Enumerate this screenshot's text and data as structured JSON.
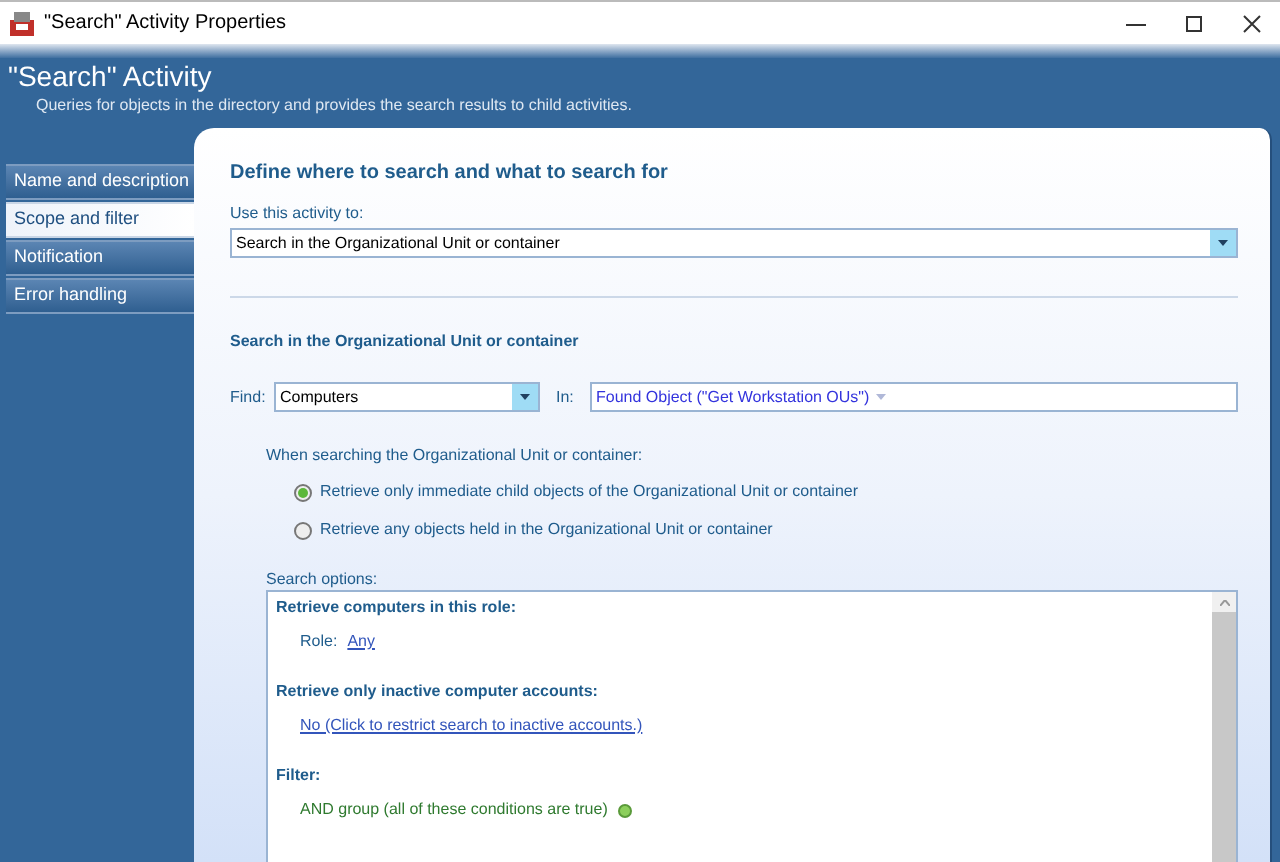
{
  "window": {
    "title": "\"Search\" Activity Properties"
  },
  "header": {
    "title": "\"Search\" Activity",
    "subtitle": "Queries for objects in the directory and provides the search results to child activities."
  },
  "sidebar": {
    "items": [
      {
        "label": "Name and description",
        "selected": false
      },
      {
        "label": "Scope and filter",
        "selected": true
      },
      {
        "label": "Notification",
        "selected": false
      },
      {
        "label": "Error handling",
        "selected": false
      }
    ]
  },
  "panel": {
    "heading": "Define where to search and what to search for",
    "use_label": "Use this activity to:",
    "use_value": "Search in the Organizational Unit or container",
    "section_heading": "Search in the Organizational Unit or container",
    "find_label": "Find:",
    "find_value": "Computers",
    "in_label": "In:",
    "in_value": "Found Object (\"Get Workstation OUs\")",
    "scope_label": "When searching the Organizational Unit or container:",
    "radios": [
      {
        "label": "Retrieve only immediate child objects of the Organizational Unit or container",
        "selected": true
      },
      {
        "label": "Retrieve any objects held in the Organizational Unit or container",
        "selected": false
      }
    ],
    "options_label": "Search options:",
    "options": [
      {
        "heading": "Retrieve computers in this role:",
        "items": [
          {
            "kind": "labeled-link",
            "label": "Role:",
            "link": "Any"
          }
        ]
      },
      {
        "heading": "Retrieve only inactive computer accounts:",
        "items": [
          {
            "kind": "link",
            "link": "No (Click to restrict search to inactive accounts.)"
          }
        ]
      },
      {
        "heading": "Filter:",
        "items": [
          {
            "kind": "group",
            "text": "AND group (all of these conditions are true)"
          }
        ]
      }
    ]
  }
}
